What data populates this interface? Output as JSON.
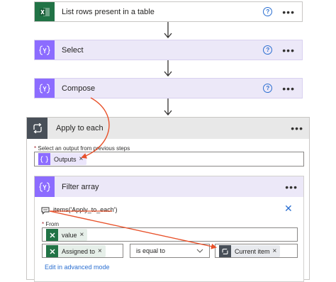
{
  "steps": {
    "list_rows": {
      "title": "List rows present in a table"
    },
    "select": {
      "title": "Select"
    },
    "compose": {
      "title": "Compose"
    }
  },
  "help_glyph": "?",
  "more_glyph": "•••",
  "apply_to_each": {
    "title": "Apply to each",
    "output_label": "Select an output from previous steps",
    "output_token": "Outputs",
    "remove_glyph": "×"
  },
  "filter_array": {
    "title": "Filter array",
    "expression": "items('Apply_to_each')",
    "close_glyph": "✕",
    "from_label": "From",
    "from_token": "value",
    "left_token": "Assigned to",
    "operator": "is equal to",
    "right_token": "Current item",
    "advanced_link": "Edit in advanced mode"
  },
  "required_mark": "*",
  "colors": {
    "excel": "#217346",
    "data_ops": "#8c6cff",
    "control": "#484f58",
    "annotation": "#e8512a",
    "link": "#2b6fd1"
  },
  "icons": {
    "excel": "excel-icon",
    "data_operation": "data-operation-icon",
    "loop": "loop-icon",
    "comment": "comment-icon",
    "close": "close-icon",
    "chevron": "chevron-down-icon"
  }
}
